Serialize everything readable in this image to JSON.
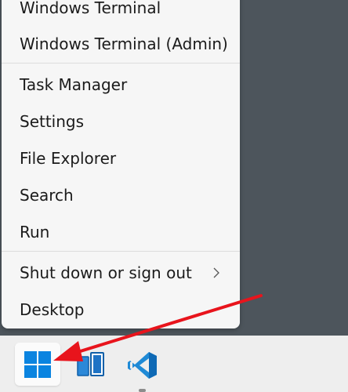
{
  "context_menu": {
    "items": [
      {
        "label": "Windows Terminal"
      },
      {
        "label": "Windows Terminal (Admin)"
      },
      {
        "label": "Task Manager"
      },
      {
        "label": "Settings"
      },
      {
        "label": "File Explorer"
      },
      {
        "label": "Search"
      },
      {
        "label": "Run"
      },
      {
        "label": "Shut down or sign out",
        "submenu_icon": "chevron-right-icon"
      },
      {
        "label": "Desktop"
      }
    ]
  },
  "taskbar": {
    "apps": [
      {
        "name": "Start",
        "icon": "windows-logo-icon"
      },
      {
        "name": "Task View",
        "icon": "task-view-icon"
      },
      {
        "name": "Visual Studio Code",
        "icon": "vscode-icon",
        "running": true
      }
    ]
  },
  "annotation": {
    "arrow_color": "#e8141c"
  },
  "colors": {
    "desktop_background": "#4d555c",
    "menu_background": "#f6f6f6",
    "taskbar_background": "#eeeeee",
    "windows_blue": "#0a84e0"
  }
}
